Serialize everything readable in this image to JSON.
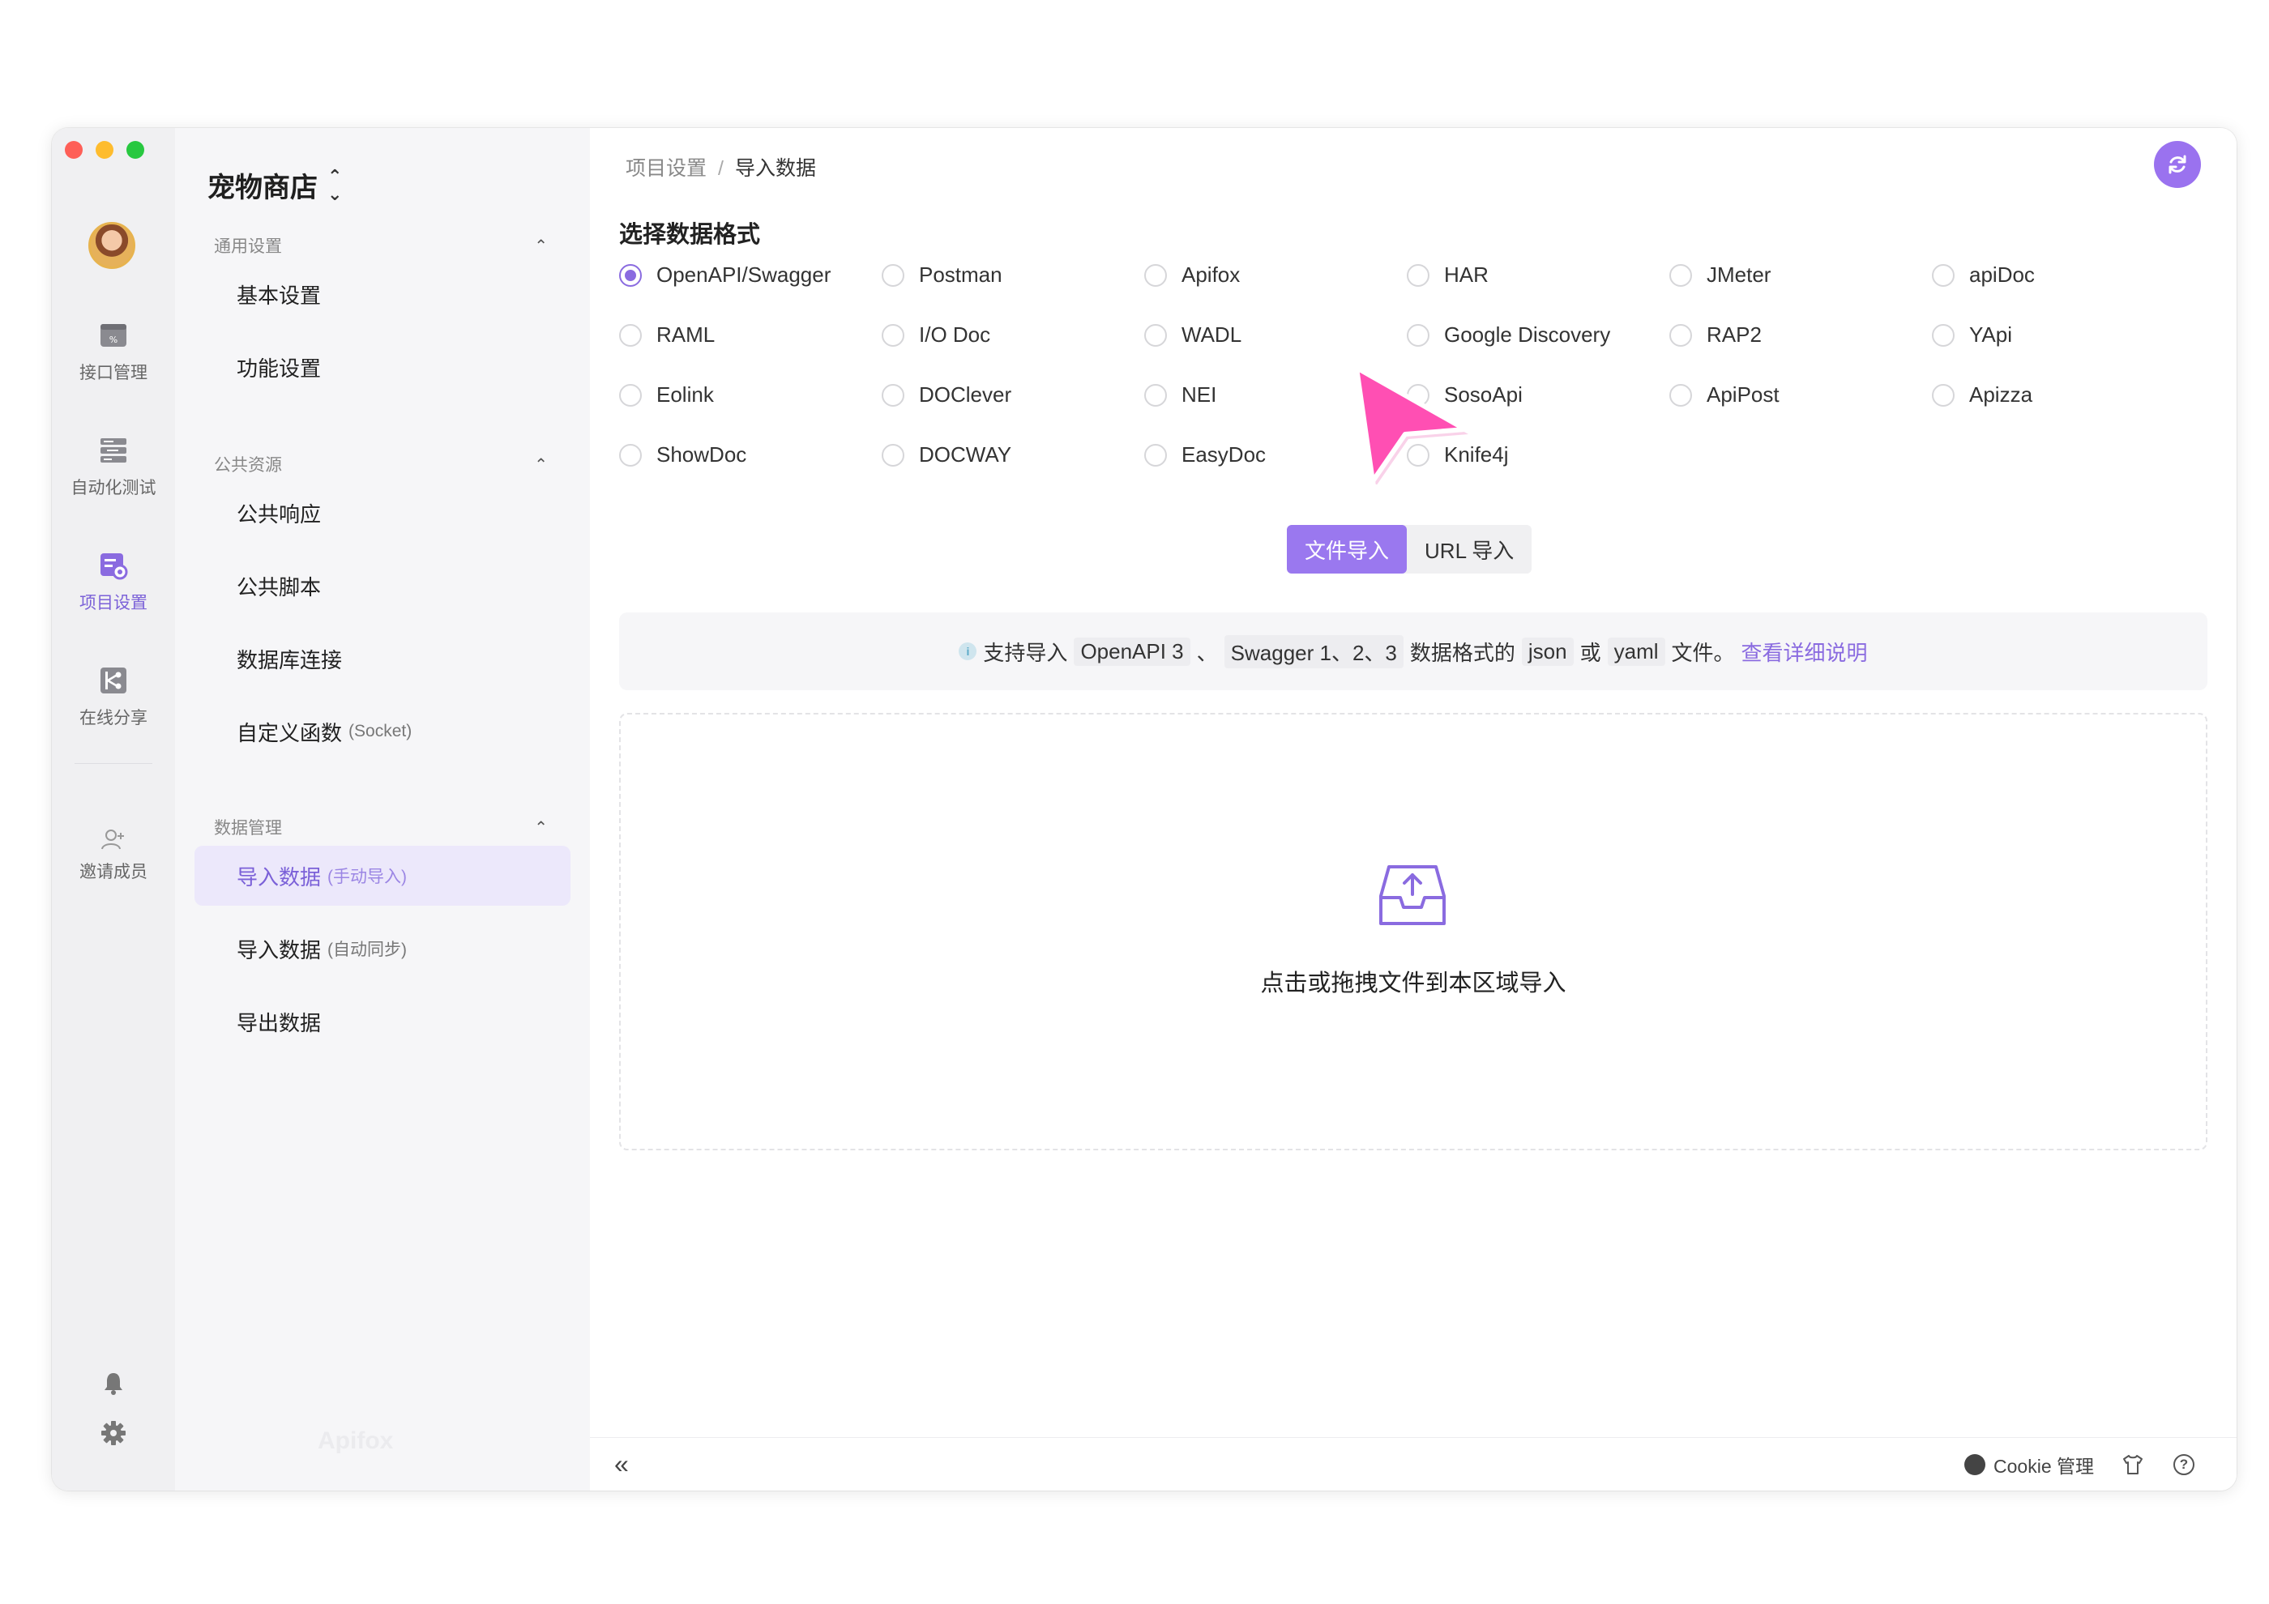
{
  "rail": {
    "items": [
      {
        "label": "接口管理",
        "icon": "api-icon"
      },
      {
        "label": "自动化测试",
        "icon": "automation-icon"
      },
      {
        "label": "项目设置",
        "icon": "settings-project-icon"
      },
      {
        "label": "在线分享",
        "icon": "share-icon"
      }
    ],
    "invite_label": "邀请成员"
  },
  "sidebar": {
    "project_name": "宠物商店",
    "groups": [
      {
        "title": "通用设置",
        "items": [
          {
            "label": "基本设置"
          },
          {
            "label": "功能设置"
          }
        ]
      },
      {
        "title": "公共资源",
        "items": [
          {
            "label": "公共响应"
          },
          {
            "label": "公共脚本"
          },
          {
            "label": "数据库连接"
          },
          {
            "label": "自定义函数",
            "sub": "(Socket)"
          }
        ]
      },
      {
        "title": "数据管理",
        "items": [
          {
            "label": "导入数据",
            "sub": "(手动导入)"
          },
          {
            "label": "导入数据",
            "sub": "(自动同步)"
          },
          {
            "label": "导出数据"
          }
        ]
      }
    ],
    "watermark": "Apifox"
  },
  "main": {
    "breadcrumb": [
      "项目设置",
      "导入数据"
    ],
    "section_title": "选择数据格式",
    "formats": [
      "OpenAPI/Swagger",
      "Postman",
      "Apifox",
      "HAR",
      "JMeter",
      "apiDoc",
      "RAML",
      "I/O Doc",
      "WADL",
      "Google Discovery",
      "RAP2",
      "YApi",
      "Eolink",
      "DOClever",
      "NEI",
      "SosoApi",
      "ApiPost",
      "Apizza",
      "ShowDoc",
      "DOCWAY",
      "EasyDoc",
      "Knife4j"
    ],
    "selected_format": "OpenAPI/Swagger",
    "tabs": [
      "文件导入",
      "URL 导入"
    ],
    "info": {
      "prefix": "支持导入",
      "code1": "OpenAPI 3",
      "sep1": "、",
      "code2": "Swagger 1、2、3",
      "mid": "数据格式的",
      "code3": "json",
      "or": "或",
      "code4": "yaml",
      "suffix": "文件。",
      "link": "查看详细说明"
    },
    "dropzone_text": "点击或拖拽文件到本区域导入"
  },
  "footer": {
    "collapse": "«",
    "cookie_label": "Cookie 管理",
    "help": "?"
  },
  "colors": {
    "accent": "#8a6be0",
    "cursor": "#ff4fb3"
  }
}
